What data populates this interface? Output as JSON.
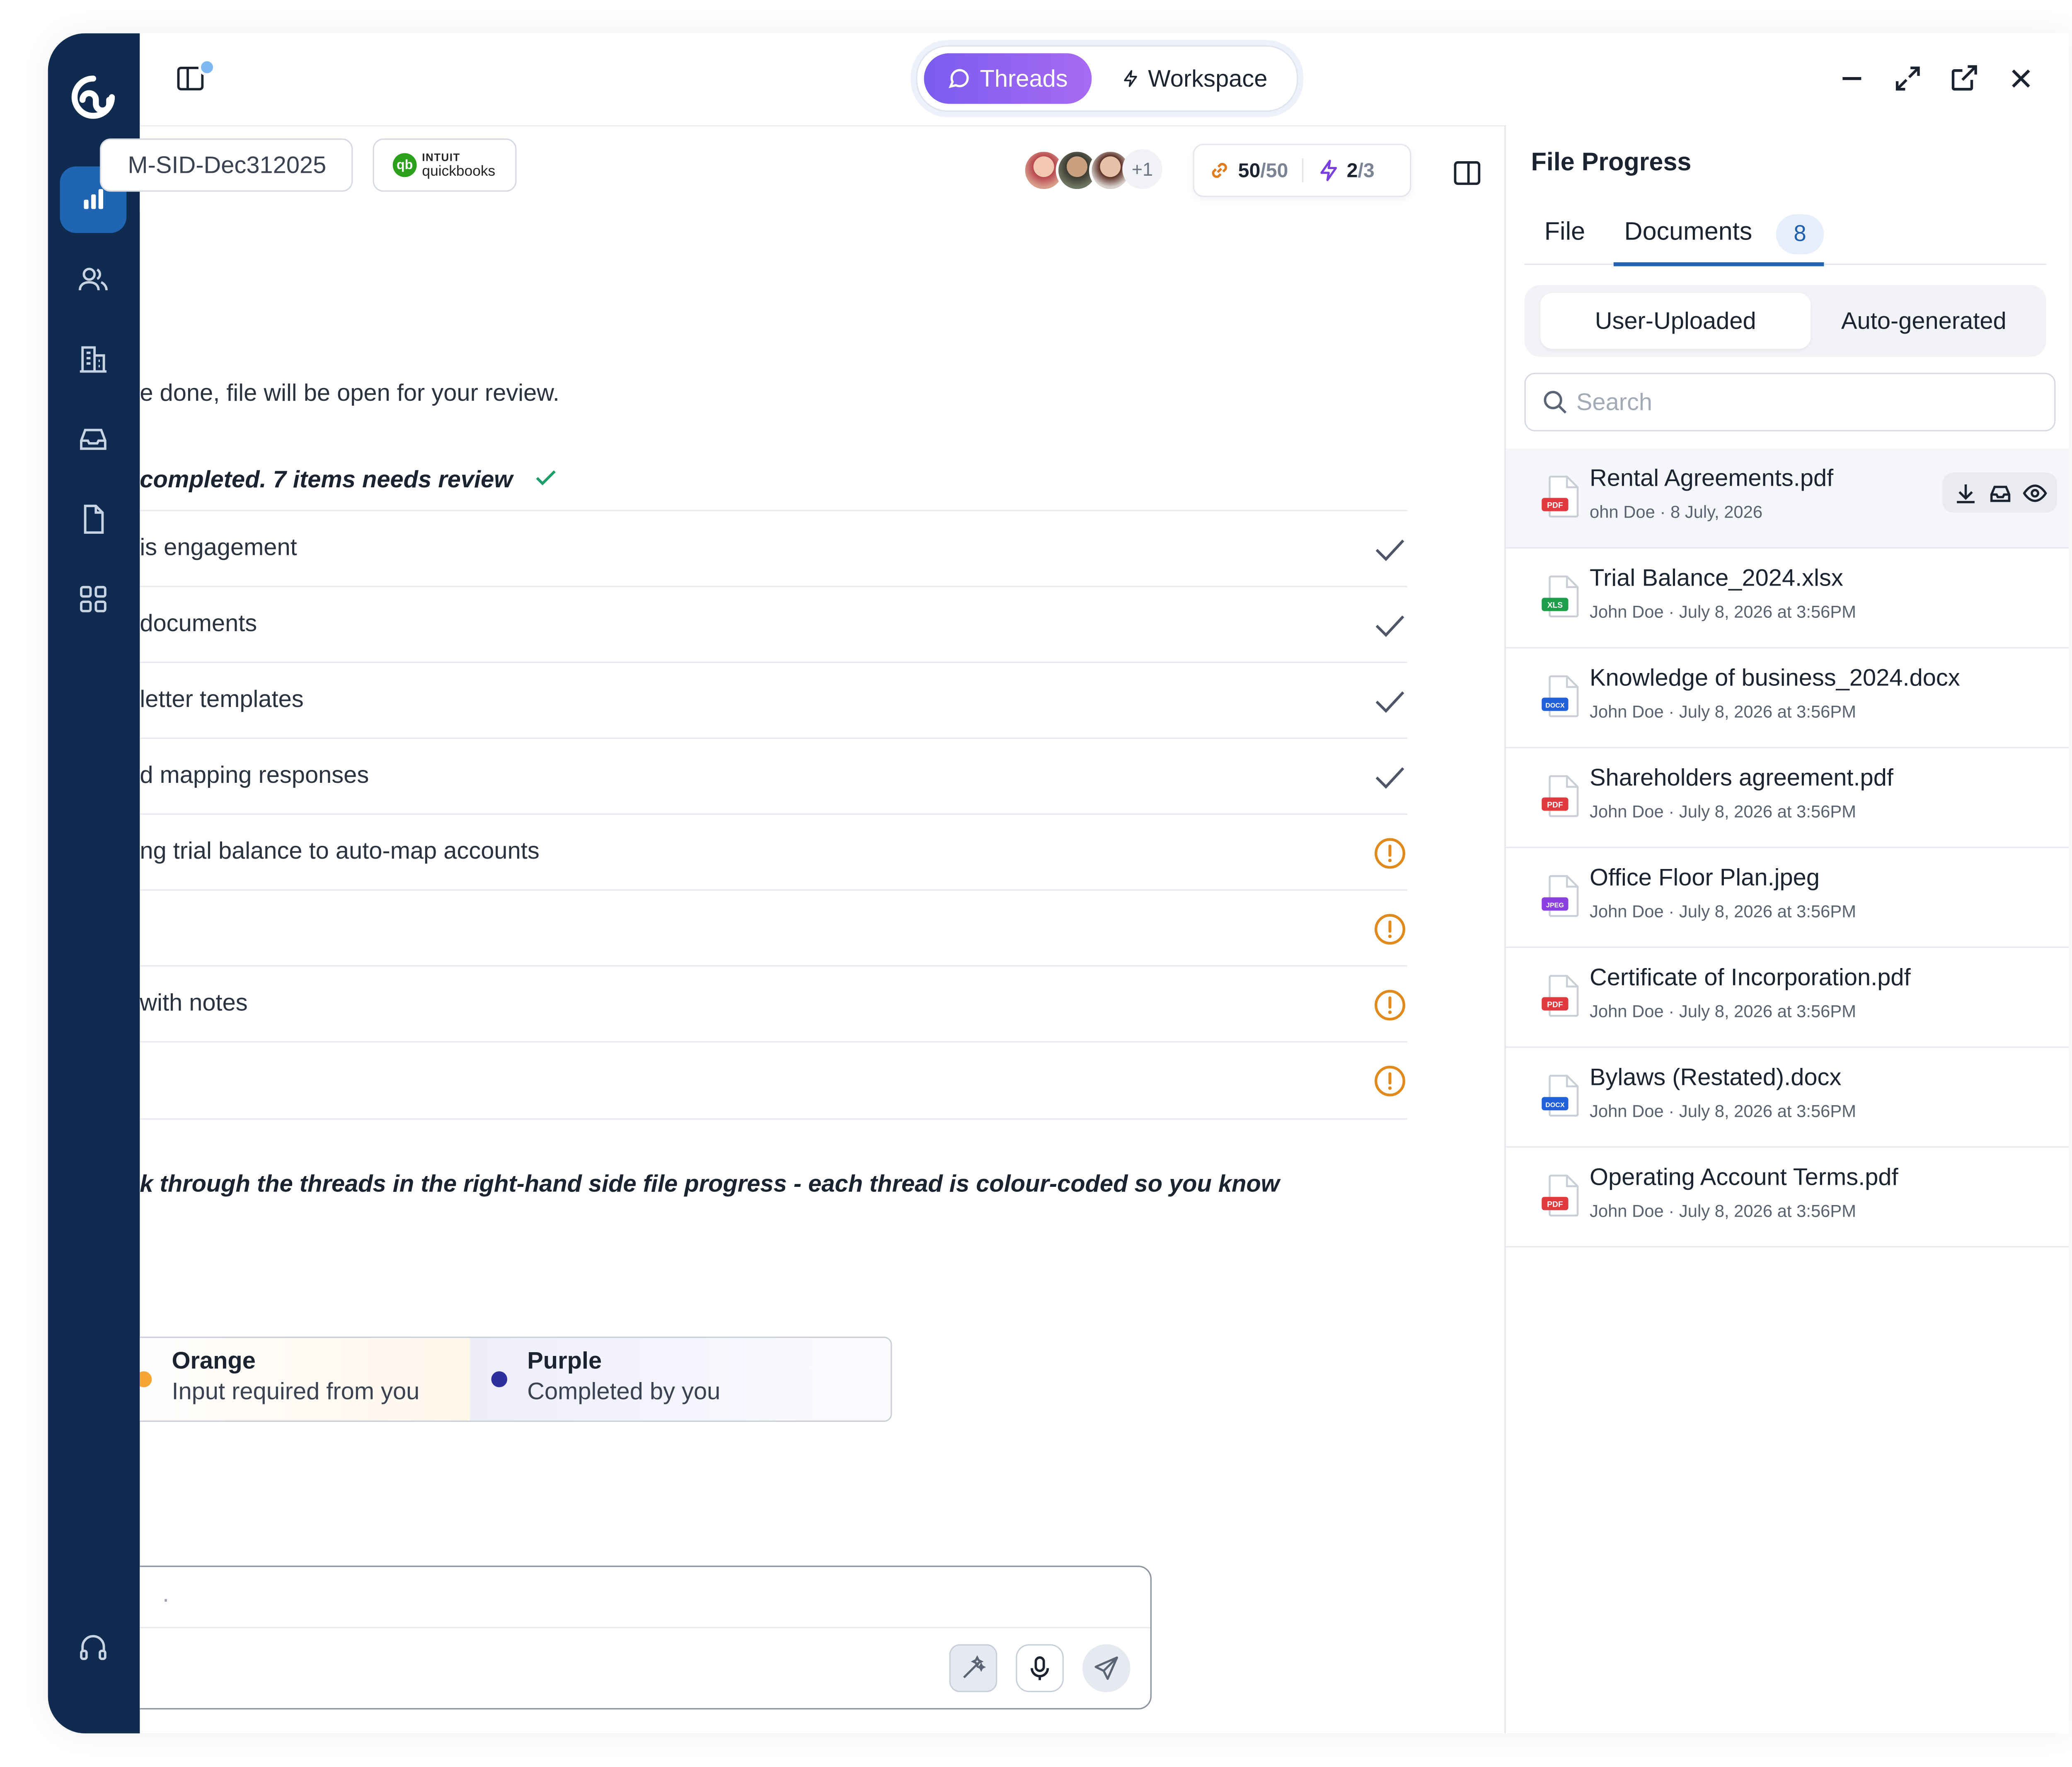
{
  "topbar": {
    "modes": [
      {
        "label": "Threads",
        "active": true
      },
      {
        "label": "Workspace",
        "active": false
      }
    ]
  },
  "toolbar": {
    "file_id": "M-SID-Dec312025",
    "integration": {
      "top": "INTUIT",
      "bottom": "quickbooks",
      "mark": "qb"
    },
    "avatars_more": "+1",
    "counter_a": {
      "value": "50",
      "total": "/50"
    },
    "counter_b": {
      "value": "2",
      "total": "/3"
    }
  },
  "chat": {
    "intro": "e done, file will be open for your review.",
    "status_line": "completed. 7 items needs review",
    "checklist": [
      {
        "text": "is engagement",
        "status": "done"
      },
      {
        "text": "documents",
        "status": "done"
      },
      {
        "text": "letter templates",
        "status": "done"
      },
      {
        "text": "d mapping responses",
        "status": "done"
      },
      {
        "text": "ng trial balance to auto-map accounts",
        "status": "warning"
      },
      {
        "text": "",
        "status": "warning"
      },
      {
        "text": " with notes",
        "status": "warning"
      },
      {
        "text": "",
        "status": "warning"
      }
    ],
    "guidance": "k through the threads in the right-hand side file progress - each thread is colour-coded so you know",
    "legend": [
      {
        "name": "Orange",
        "desc": "Input required from you",
        "color": "#f4a534"
      },
      {
        "name": "Purple",
        "desc": "Completed by you",
        "color": "#2d2f9e"
      }
    ],
    "composer_placeholder": "."
  },
  "file_progress": {
    "title": "File Progress",
    "tabs": [
      {
        "label": "File"
      },
      {
        "label": "Documents",
        "count": "8"
      }
    ],
    "segments": [
      "User-Uploaded",
      "Auto-generated"
    ],
    "search_placeholder": "Search",
    "documents": [
      {
        "name": "Rental Agreements.pdf",
        "meta": "ohn Doe · 8 July, 2026",
        "type": "PDF",
        "color": "#e0393e"
      },
      {
        "name": "Trial Balance_2024.xlsx",
        "meta": "John Doe · July 8, 2026 at 3:56PM",
        "type": "XLS",
        "color": "#1e9e4a"
      },
      {
        "name": "Knowledge of business_2024.docx",
        "meta": "John Doe · July 8, 2026 at 3:56PM",
        "type": "DOCX",
        "color": "#2160d8"
      },
      {
        "name": "Shareholders agreement.pdf",
        "meta": "John Doe · July 8, 2026 at 3:56PM",
        "type": "PDF",
        "color": "#e0393e"
      },
      {
        "name": "Office Floor Plan.jpeg",
        "meta": "John Doe · July 8, 2026 at 3:56PM",
        "type": "JPEG",
        "color": "#8a3fe0"
      },
      {
        "name": "Certificate of Incorporation.pdf",
        "meta": "John Doe · July 8, 2026 at 3:56PM",
        "type": "PDF",
        "color": "#e0393e"
      },
      {
        "name": "Bylaws (Restated).docx",
        "meta": "John Doe · July 8, 2026 at 3:56PM",
        "type": "DOCX",
        "color": "#2160d8"
      },
      {
        "name": "Operating Account Terms.pdf",
        "meta": "John Doe · July 8, 2026 at 3:56PM",
        "type": "PDF",
        "color": "#e0393e"
      }
    ]
  },
  "colors": {
    "rail": "#0f2b4f",
    "rail_active": "#1f65b2",
    "accent": "#7a5cf0",
    "warning": "#e08a1e",
    "done": "#4d5566"
  }
}
